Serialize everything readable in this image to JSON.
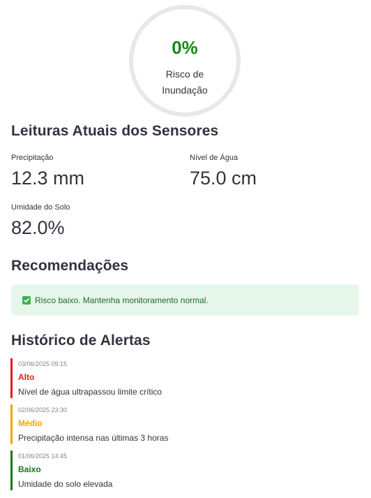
{
  "risk": {
    "percent": "0%",
    "label": "Risco de\nInundação"
  },
  "sensors": {
    "title": "Leituras Atuais dos Sensores",
    "precipitation": {
      "label": "Precipitação",
      "value": "12.3 mm"
    },
    "water_level": {
      "label": "Nível de Água",
      "value": "75.0 cm"
    },
    "soil_humidity": {
      "label": "Umidade do Solo",
      "value": "82.0%"
    }
  },
  "recommendations": {
    "title": "Recomendações",
    "text": "Risco baixo. Mantenha monitoramento normal."
  },
  "alerts": {
    "title": "Histórico de Alertas",
    "items": [
      {
        "date": "03/06/2025 09:15",
        "level": "Alto",
        "message": "Nível de água ultrapassou limite crítico",
        "color": "#e01b1b"
      },
      {
        "date": "02/06/2025 23:30",
        "level": "Médio",
        "message": "Precipitação intensa nas últimas 3 horas",
        "color": "#f0a500"
      },
      {
        "date": "01/06/2025 14:45",
        "level": "Baixo",
        "message": "Umidade do solo elevada",
        "color": "#137a13"
      }
    ]
  },
  "colors": {
    "risk_green": "#158a15",
    "success_bg": "#e6f6ea",
    "success_text": "#1f6b2d"
  }
}
